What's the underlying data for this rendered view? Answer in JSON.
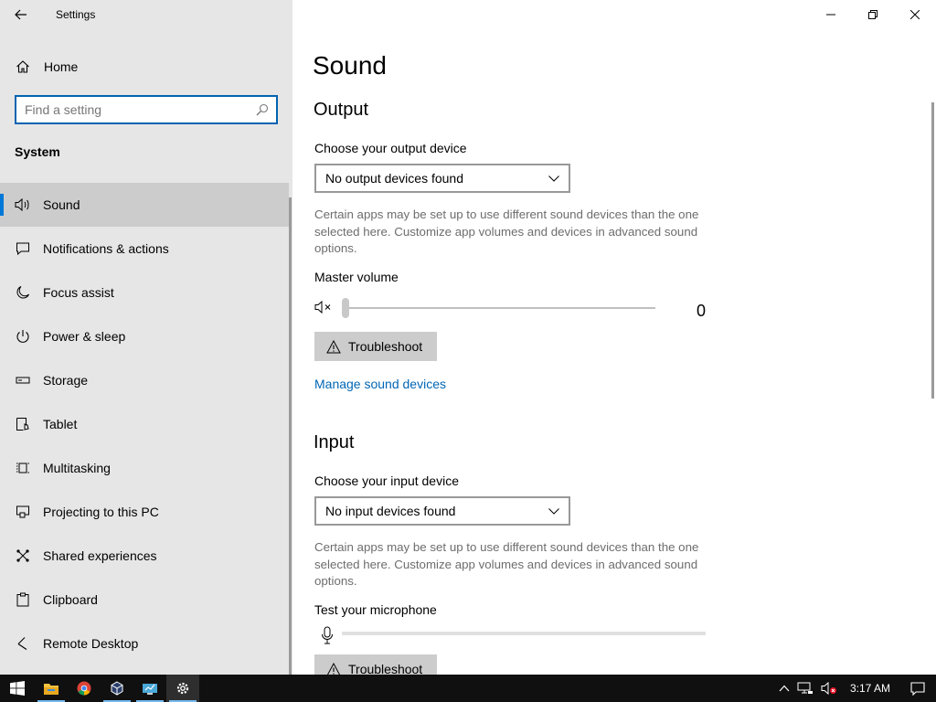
{
  "window": {
    "title": "Settings"
  },
  "sidebar": {
    "home_label": "Home",
    "search_placeholder": "Find a setting",
    "section": "System",
    "items": [
      {
        "label": "Sound",
        "icon": "speaker-icon"
      },
      {
        "label": "Notifications & actions",
        "icon": "notification-icon"
      },
      {
        "label": "Focus assist",
        "icon": "moon-icon"
      },
      {
        "label": "Power & sleep",
        "icon": "power-icon"
      },
      {
        "label": "Storage",
        "icon": "storage-icon"
      },
      {
        "label": "Tablet",
        "icon": "tablet-icon"
      },
      {
        "label": "Multitasking",
        "icon": "multitasking-icon"
      },
      {
        "label": "Projecting to this PC",
        "icon": "projecting-icon"
      },
      {
        "label": "Shared experiences",
        "icon": "shared-icon"
      },
      {
        "label": "Clipboard",
        "icon": "clipboard-icon"
      },
      {
        "label": "Remote Desktop",
        "icon": "remote-desktop-icon"
      }
    ],
    "selected_index": 0
  },
  "main": {
    "title": "Sound",
    "output": {
      "heading": "Output",
      "device_label": "Choose your output device",
      "device_value": "No output devices found",
      "description": "Certain apps may be set up to use different sound devices than the one selected here. Customize app volumes and devices in advanced sound options.",
      "master_volume_label": "Master volume",
      "volume_value": "0",
      "troubleshoot_label": "Troubleshoot",
      "manage_link": "Manage sound devices"
    },
    "input": {
      "heading": "Input",
      "device_label": "Choose your input device",
      "device_value": "No input devices found",
      "description": "Certain apps may be set up to use different sound devices than the one selected here. Customize app volumes and devices in advanced sound options.",
      "test_mic_label": "Test your microphone",
      "troubleshoot_label": "Troubleshoot"
    }
  },
  "taskbar": {
    "clock": "3:17 AM",
    "colors": {
      "accent": "#0078d7",
      "link": "#0066b4"
    }
  }
}
